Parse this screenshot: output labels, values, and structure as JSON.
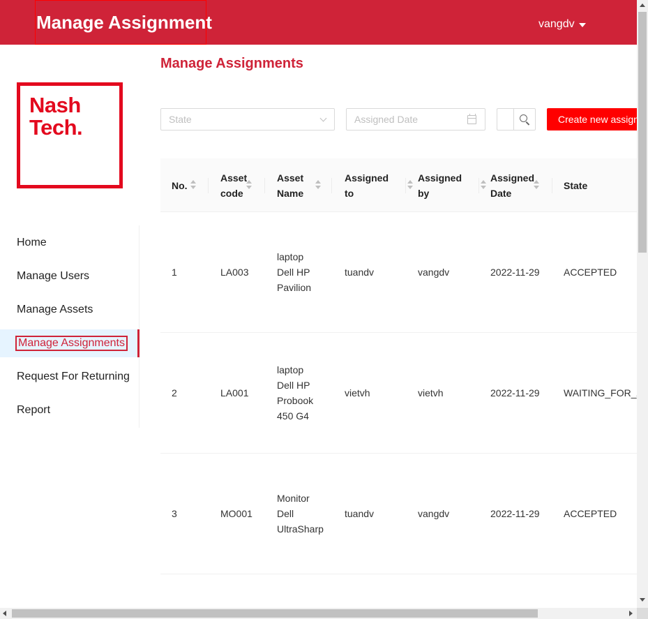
{
  "header": {
    "app_title": "Manage Assignment",
    "user_name": "vangdv",
    "background_color": "#cf2338"
  },
  "logo": {
    "text": "Nash\nTech.",
    "color": "#e3091e"
  },
  "sidebar": {
    "items": [
      {
        "label": "Home"
      },
      {
        "label": "Manage Users"
      },
      {
        "label": "Manage Assets"
      },
      {
        "label": "Manage Assignments",
        "active": true
      },
      {
        "label": "Request For Returning"
      },
      {
        "label": "Report"
      }
    ]
  },
  "page": {
    "heading": "Manage Assignments"
  },
  "filters": {
    "state_placeholder": "State",
    "date_placeholder": "Assigned Date",
    "search_value": "",
    "create_button_label": "Create new assign"
  },
  "table": {
    "columns": [
      {
        "label": "No."
      },
      {
        "label": "Asset code"
      },
      {
        "label": "Asset Name"
      },
      {
        "label": "Assigned to"
      },
      {
        "label": "Assigned by"
      },
      {
        "label": "Assigned Date"
      },
      {
        "label": "State"
      }
    ],
    "rows": [
      {
        "no": "1",
        "code": "LA003",
        "name": "laptop\nDell HP\nPavilion",
        "to": "tuandv",
        "by": "vangdv",
        "date": "2022-11-29",
        "state": "ACCEPTED"
      },
      {
        "no": "2",
        "code": "LA001",
        "name": "laptop\nDell HP\nProbook\n450 G4",
        "to": "vietvh",
        "by": "vietvh",
        "date": "2022-11-29",
        "state": "WAITING_FOR_AC"
      },
      {
        "no": "3",
        "code": "MO001",
        "name": "Monitor\nDell\nUltraSharp",
        "to": "tuandv",
        "by": "vangdv",
        "date": "2022-11-29",
        "state": "ACCEPTED"
      }
    ]
  },
  "colors": {
    "accent": "#cf2338",
    "create_button": "#ff0000"
  }
}
